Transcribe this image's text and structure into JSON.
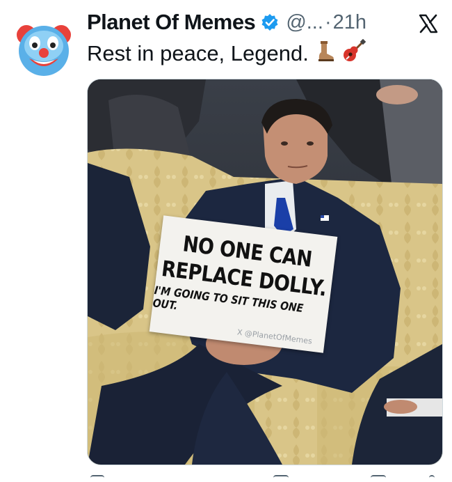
{
  "user": {
    "display_name": "Planet Of Memes",
    "handle": "@...",
    "separator": "·",
    "time": "21h",
    "avatar_icon": "clown-face-icon",
    "verified_color": "#1d9bf0"
  },
  "tweet": {
    "text": "Rest in peace, Legend.",
    "emojis": [
      "cowboy-boot-icon",
      "guitar-icon"
    ]
  },
  "media": {
    "sign": {
      "line1": "NO ONE CAN",
      "line2": "REPLACE DOLLY.",
      "line3": "I'M GOING TO SIT THIS ONE OUT.",
      "watermark": "X @PlanetOfMemes"
    }
  },
  "colors": {
    "text_primary": "#0f1419",
    "text_secondary": "#536471",
    "border": "#cfd9de"
  }
}
